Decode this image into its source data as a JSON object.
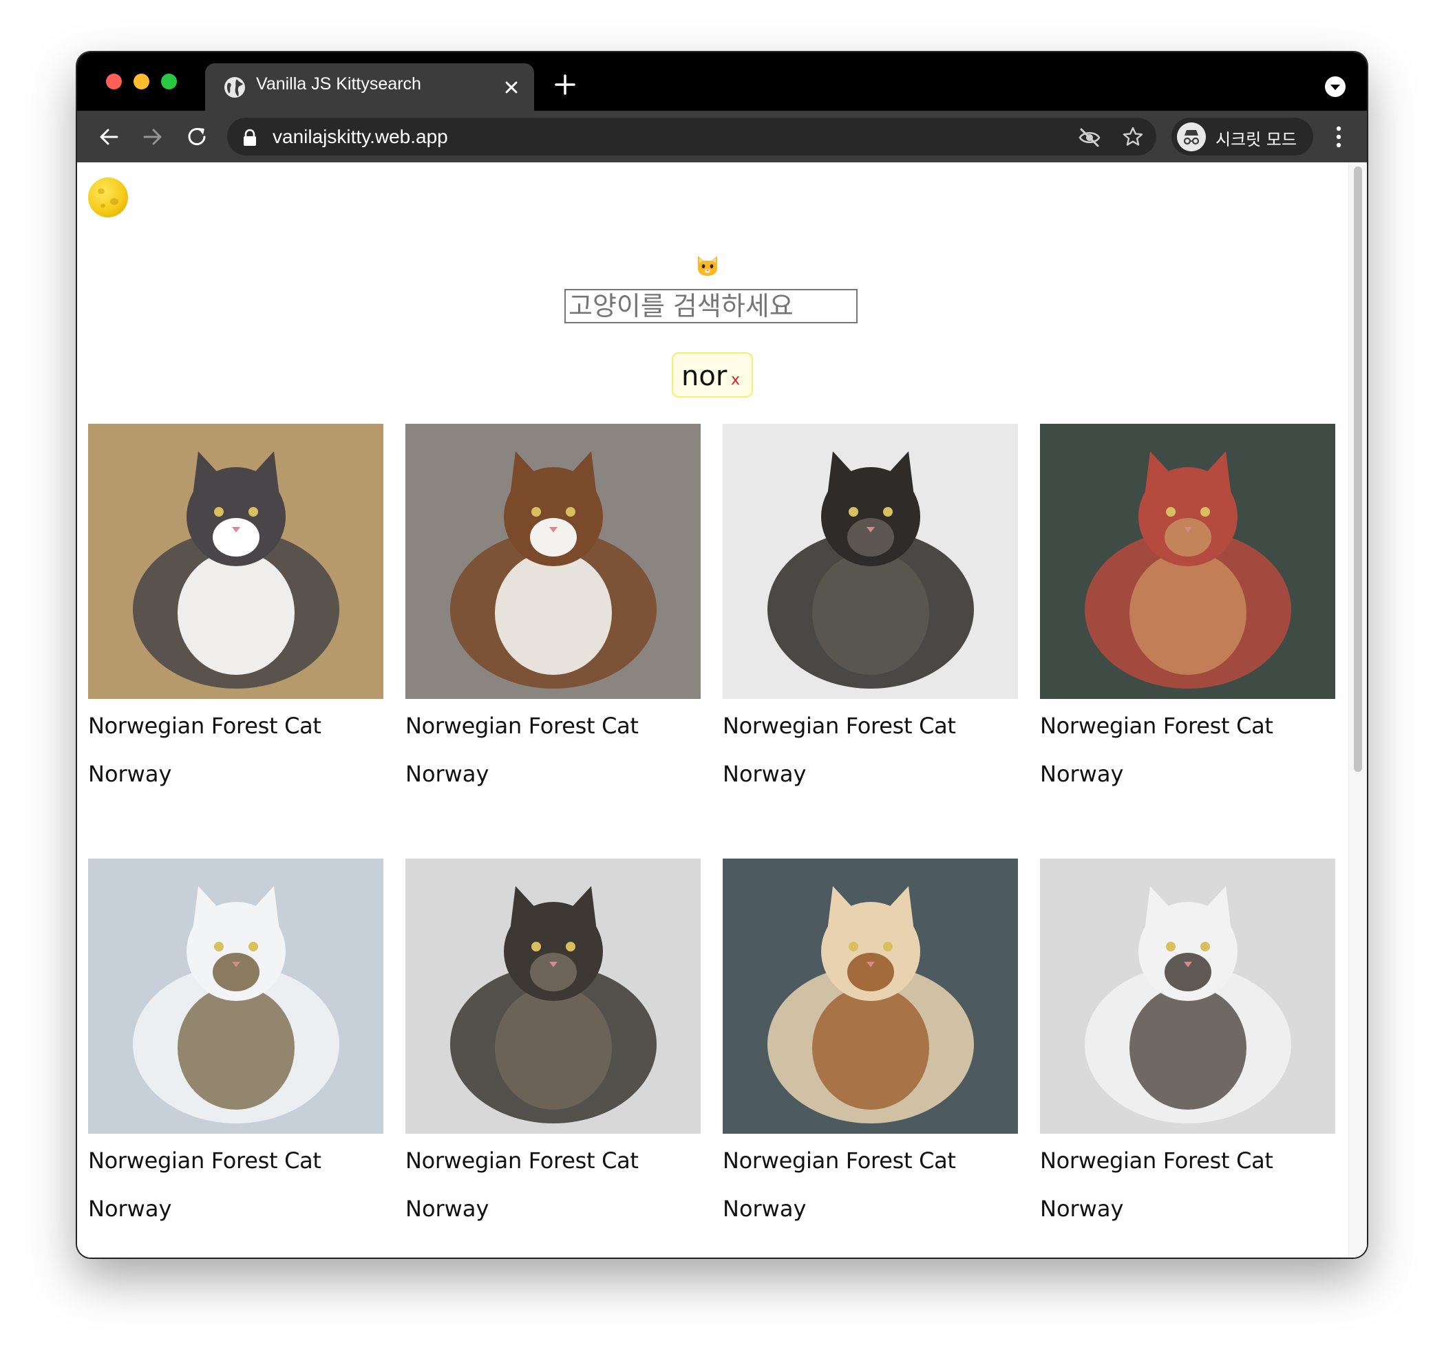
{
  "browser": {
    "tab_title": "Vanilla JS Kittysearch",
    "url": "vanilajskitty.web.app",
    "incognito_label": "시크릿 모드"
  },
  "page": {
    "theme_toggle_icon": "moon-icon",
    "cat_emoji_icon": "cat-face-icon",
    "search_placeholder": "고양이를 검색하세요",
    "keyword_chip": {
      "text": "nor",
      "remove": "x"
    }
  },
  "results": [
    {
      "name": "Norwegian Forest Cat",
      "origin": "Norway",
      "palette": [
        "#b79a6c",
        "#ffffff",
        "#4a4548"
      ]
    },
    {
      "name": "Norwegian Forest Cat",
      "origin": "Norway",
      "palette": [
        "#8a8580",
        "#f4f2ef",
        "#7a4a2a"
      ]
    },
    {
      "name": "Norwegian Forest Cat",
      "origin": "Norway",
      "palette": [
        "#e9e9ea",
        "#5b5650",
        "#2e2b28"
      ]
    },
    {
      "name": "Norwegian Forest Cat",
      "origin": "Norway",
      "palette": [
        "#3f4b45",
        "#c4845a",
        "#b54a3e"
      ]
    },
    {
      "name": "Norwegian Forest Cat",
      "origin": "Norway",
      "palette": [
        "#c7d0d8",
        "#8a7a60",
        "#f2f4f6"
      ]
    },
    {
      "name": "Norwegian Forest Cat",
      "origin": "Norway",
      "palette": [
        "#d8d8d8",
        "#6e655a",
        "#3d3833"
      ]
    },
    {
      "name": "Norwegian Forest Cat",
      "origin": "Norway",
      "palette": [
        "#4d5a60",
        "#a36a3c",
        "#e8d2b0"
      ]
    },
    {
      "name": "Norwegian Forest Cat",
      "origin": "Norway",
      "palette": [
        "#dadada",
        "#5f5a55",
        "#f2f2f2"
      ]
    }
  ]
}
